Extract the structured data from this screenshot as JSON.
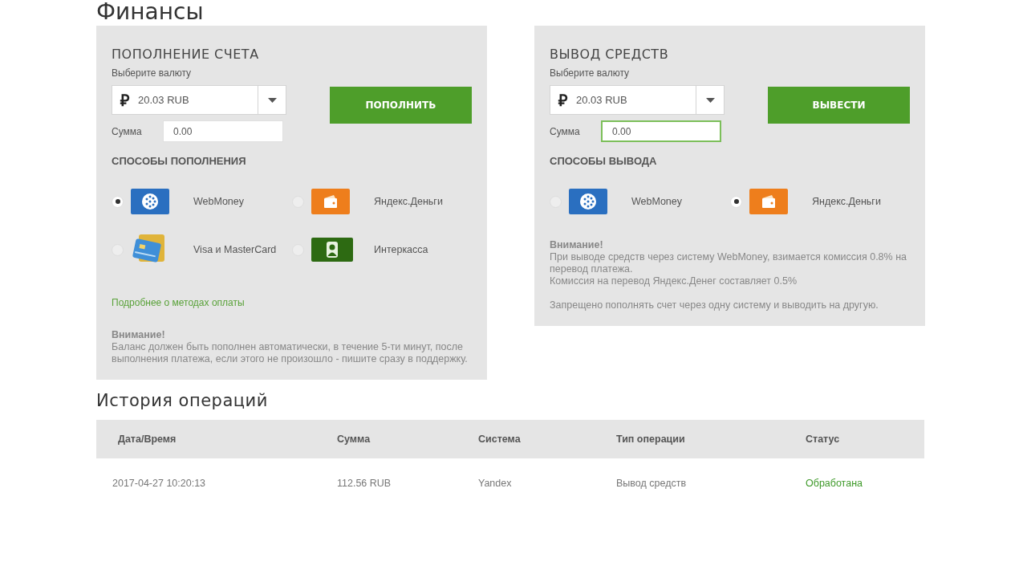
{
  "page_title": "Финансы",
  "panels": [
    {
      "title": "ПОПОЛНЕНИЕ СЧЕТА",
      "currency_label": "Выберите валюту",
      "currency_symbol": "₽",
      "currency_value": "20.03 RUB",
      "amount_label": "Сумма",
      "amount_value": "0.00",
      "amount_focused": false,
      "button": "ПОПОЛНИТЬ",
      "methods_title": "СПОСОБЫ ПОПОЛНЕНИЯ",
      "methods": [
        {
          "kind": "webmoney",
          "name": "WebMoney",
          "selected": true
        },
        {
          "kind": "yandex",
          "name": "Яндекс.Деньги",
          "selected": false
        },
        {
          "kind": "cards",
          "name": "Visa и MasterCard",
          "selected": false
        },
        {
          "kind": "interkassa",
          "name": "Интеркасса",
          "selected": false
        }
      ],
      "link": "Подробнее о методах оплаты",
      "notice_title": "Внимание!",
      "notice_paragraphs": [
        [
          "Баланс должен быть пополнен автоматически, в течение 5-ти минут, после выполнения платежа, если этого не произошло - пишите сразу в поддержку."
        ]
      ]
    },
    {
      "title": "ВЫВОД СРЕДСТВ",
      "currency_label": "Выберите валюту",
      "currency_symbol": "₽",
      "currency_value": "20.03 RUB",
      "amount_label": "Сумма",
      "amount_value": "0.00",
      "amount_focused": true,
      "button": "ВЫВЕСТИ",
      "methods_title": "СПОСОБЫ ВЫВОДА",
      "methods": [
        {
          "kind": "webmoney",
          "name": "WebMoney",
          "selected": false
        },
        {
          "kind": "yandex",
          "name": "Яндекс.Деньги",
          "selected": true
        }
      ],
      "notice_title": "Внимание!",
      "notice_paragraphs": [
        [
          "При выводе средств через систему WebMoney, взимается комиссия 0.8% на перевод платежа.",
          "Комиссия на перевод Яндекс.Денег составляет 0.5%"
        ],
        [
          "Запрещено пополнять счет через одну систему и выводить на другую."
        ]
      ]
    }
  ],
  "history": {
    "title": "История операций",
    "columns": [
      "Дата/Время",
      "Сумма",
      "Система",
      "Тип операции",
      "Статус"
    ],
    "rows": [
      {
        "cells": [
          "2017-04-27 10:20:13",
          "112.56 RUB",
          "Yandex",
          "Вывод средств",
          "Обработана"
        ]
      }
    ]
  }
}
